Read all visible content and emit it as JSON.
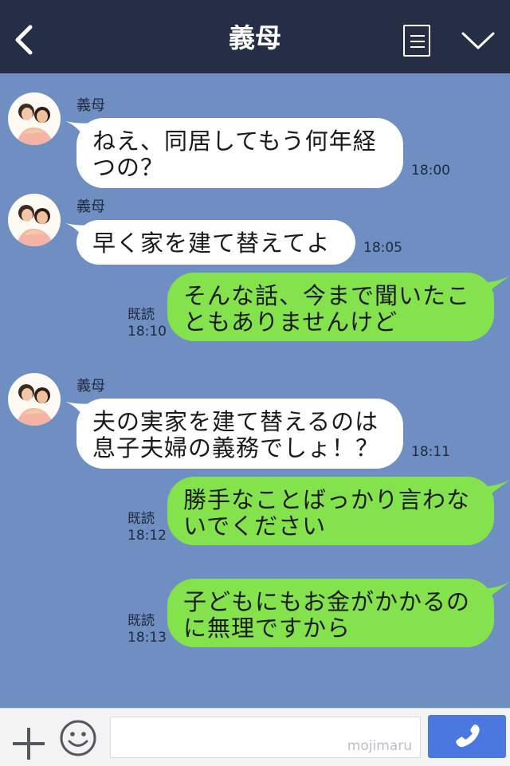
{
  "header": {
    "title": "義母",
    "back_icon": "chevron-left-icon",
    "menu_icon": "menu-icon",
    "collapse_icon": "chevron-down-icon"
  },
  "messages": [
    {
      "side": "in",
      "sender": "義母",
      "lines": [
        "ねえ、同居してもう何年経",
        "つの？"
      ],
      "time": "18:00"
    },
    {
      "side": "in",
      "sender": "義母",
      "lines": [
        "早く家を建て替えてよ"
      ],
      "time": "18:05"
    },
    {
      "side": "out",
      "read": "既読",
      "lines": [
        "そんな話、今まで聞いたこ",
        "ともありませんけど"
      ],
      "time": "18:10"
    },
    {
      "side": "in",
      "sender": "義母",
      "lines": [
        "夫の実家を建て替えるのは",
        "息子夫婦の義務でしょ！？"
      ],
      "time": "18:11"
    },
    {
      "side": "out",
      "read": "既読",
      "lines": [
        "勝手なことばっかり言わな",
        "いでください"
      ],
      "time": "18:12"
    },
    {
      "side": "out",
      "read": "既読",
      "lines": [
        "子どもにもお金がかかるの",
        "に無理ですから"
      ],
      "time": "18:13"
    }
  ],
  "footer": {
    "watermark": "mojimaru",
    "plus_icon": "plus-icon",
    "emoji_icon": "smiley-icon",
    "call_icon": "phone-icon"
  },
  "colors": {
    "header_bg": "#252e45",
    "chat_bg": "#6f8fc2",
    "incoming_bubble": "#ffffff",
    "outgoing_bubble": "#84e24d",
    "call_button": "#4a78e0"
  }
}
